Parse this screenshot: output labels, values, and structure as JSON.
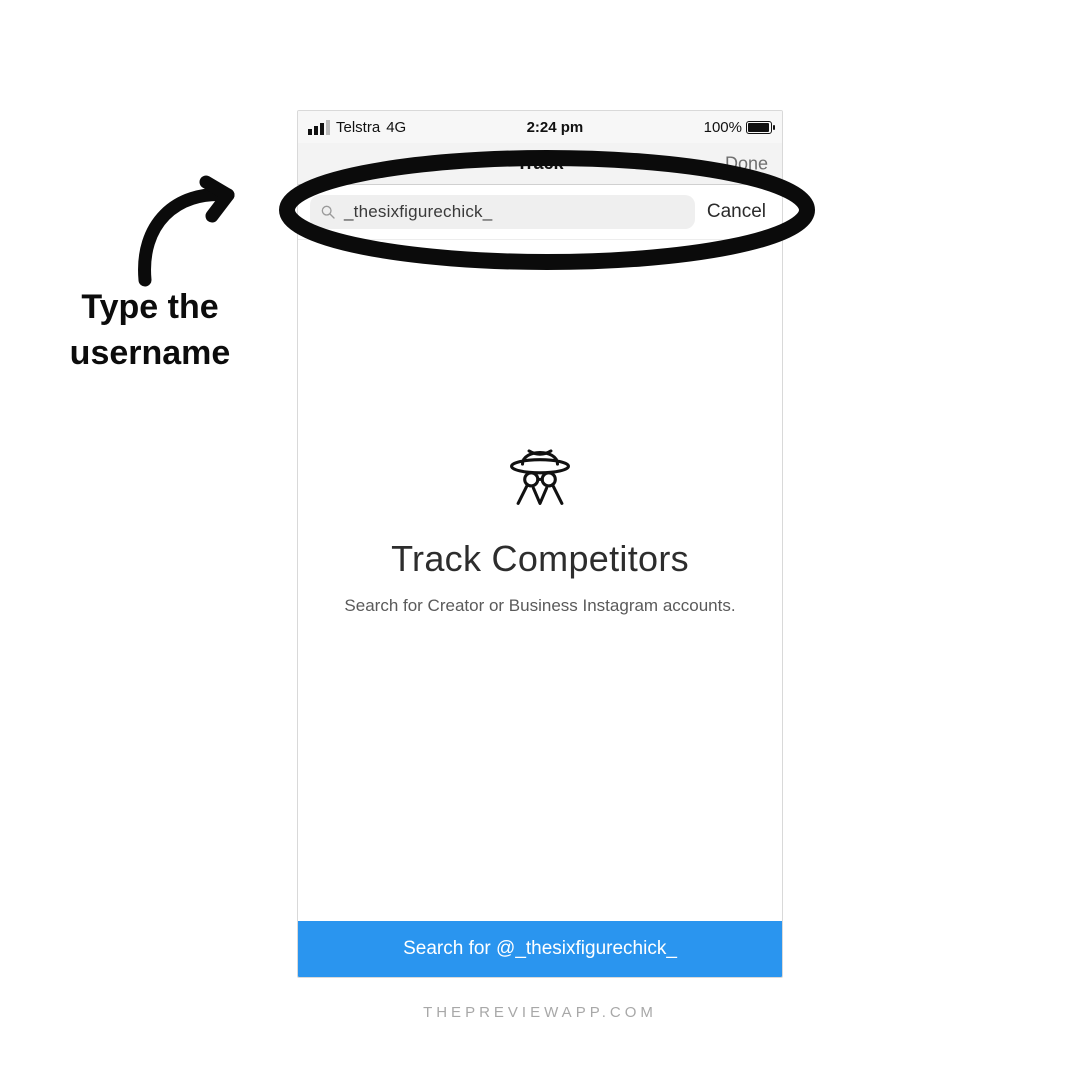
{
  "status": {
    "carrier": "Telstra",
    "network": "4G",
    "time": "2:24 pm",
    "battery_pct": "100%"
  },
  "nav": {
    "title": "Track",
    "done_label": "Done"
  },
  "search": {
    "value": "_thesixfigurechick_",
    "cancel_label": "Cancel"
  },
  "body": {
    "title": "Track Competitors",
    "subtitle": "Search for Creator or Business Instagram accounts."
  },
  "action": {
    "label": "Search for @_thesixfigurechick_"
  },
  "annotation": {
    "line1": "Type the",
    "line2": "username"
  },
  "watermark": "THEPREVIEWAPP.COM"
}
